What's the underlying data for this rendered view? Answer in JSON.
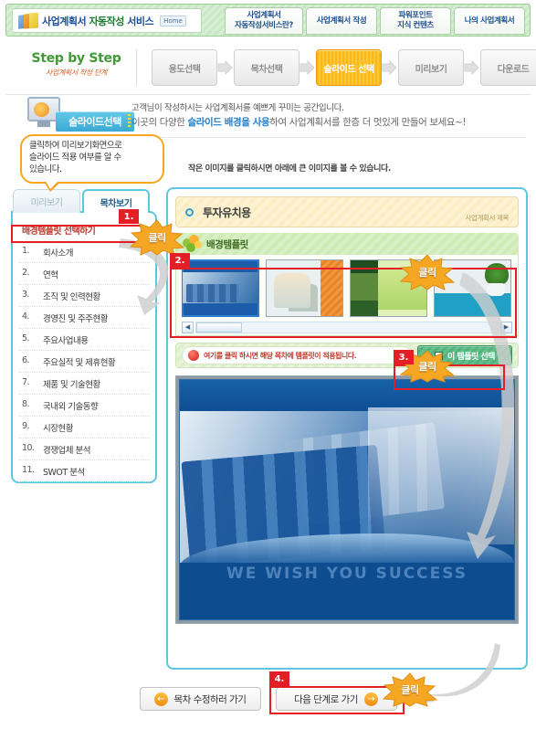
{
  "header": {
    "logo_text_1": "사업계획서 ",
    "logo_text_2": "자동작성",
    "logo_text_3": " 서비스",
    "home_badge": "Home",
    "nav_tabs": [
      {
        "line1": "사업계획서",
        "line2": "자동작성서비스란?"
      },
      {
        "line1": "사업계획서 작성",
        "line2": ""
      },
      {
        "line1": "파워포인트",
        "line2": "지식 컨텐츠"
      },
      {
        "line1": "나의 사업계획서",
        "line2": ""
      }
    ]
  },
  "stepbar": {
    "title": "Step by Step",
    "subtitle": "사업계획서 작성 단계",
    "steps": [
      {
        "label": "용도선택",
        "active": false
      },
      {
        "label": "목차선택",
        "active": false
      },
      {
        "label": "슬라이드 선택",
        "active": true
      },
      {
        "label": "미리보기",
        "active": false
      },
      {
        "label": "다운로드",
        "active": false
      }
    ]
  },
  "intro": {
    "badge_label": "슬라이드선택",
    "line1": "고객님이 작성하시는 사업계획서를 예쁘게 꾸미는 공간입니다.",
    "line2_a": "이곳의 다양한 ",
    "line2_b": "슬라이드 배경을 사용",
    "line2_c": "하여 사업계획서를 한층 더 멋있게 만들어 보세요~!",
    "sub_note": "작은 이미지를 클릭하시면 아래에 큰 이미지를 볼 수 있습니다."
  },
  "callout": {
    "line1": "클릭하여 미리보기화면으로",
    "line2": "슬라이드 적용 여부를 알 수",
    "line3": "있습니다."
  },
  "left_panel": {
    "tabs": [
      {
        "label": "미리보기",
        "active": false
      },
      {
        "label": "목차보기",
        "active": true
      }
    ],
    "toc_header": "배경템플릿 선택하기",
    "toc_items": [
      {
        "num": "1.",
        "label": "회사소개"
      },
      {
        "num": "2.",
        "label": "연혁"
      },
      {
        "num": "3.",
        "label": "조직 및 인력현황"
      },
      {
        "num": "4.",
        "label": "경영진 및 주주현황"
      },
      {
        "num": "5.",
        "label": "주요사업내용"
      },
      {
        "num": "6.",
        "label": "주요실적 및 제휴현황"
      },
      {
        "num": "7.",
        "label": "제품 및 기술현황"
      },
      {
        "num": "8.",
        "label": "국내외 기술동향"
      },
      {
        "num": "9.",
        "label": "시장현황"
      },
      {
        "num": "10.",
        "label": "경쟁업체 분석"
      },
      {
        "num": "11.",
        "label": "SWOT 분석"
      }
    ]
  },
  "right_panel": {
    "doc_title": "투자유치용",
    "doc_title_caption": "사업계획서 제목",
    "template_section_title": "배경템플릿",
    "thumbnails": [
      {
        "name": "blue-calculator-template",
        "selected": true
      },
      {
        "name": "orange-chair-template",
        "selected": false
      },
      {
        "name": "green-nature-template",
        "selected": false
      },
      {
        "name": "teal-teapot-template",
        "selected": false
      }
    ],
    "scrollbar": {
      "left_arrow": "◀",
      "right_arrow": "▶"
    },
    "notice_text": "여기를 클릭 하시면 해당 목차에 템플릿이 적용됩니다.",
    "select_button_label": "이 템플릿 선택",
    "preview_motto": "WE WISH YOU SUCCESS"
  },
  "bottom": {
    "prev_label": "목차 수정하러 가기",
    "prev_arrow": "←",
    "next_label": "다음 단계로 가기",
    "next_arrow": "→"
  },
  "annotations": {
    "click_label": "클릭",
    "markers": [
      "1.",
      "2.",
      "3.",
      "4."
    ]
  },
  "colors": {
    "accent_red": "#e31e24",
    "accent_orange": "#f5a623",
    "panel_border_blue": "#5ec7e0",
    "step_active": "#fdb913",
    "header_green": "#c9e8c6"
  }
}
